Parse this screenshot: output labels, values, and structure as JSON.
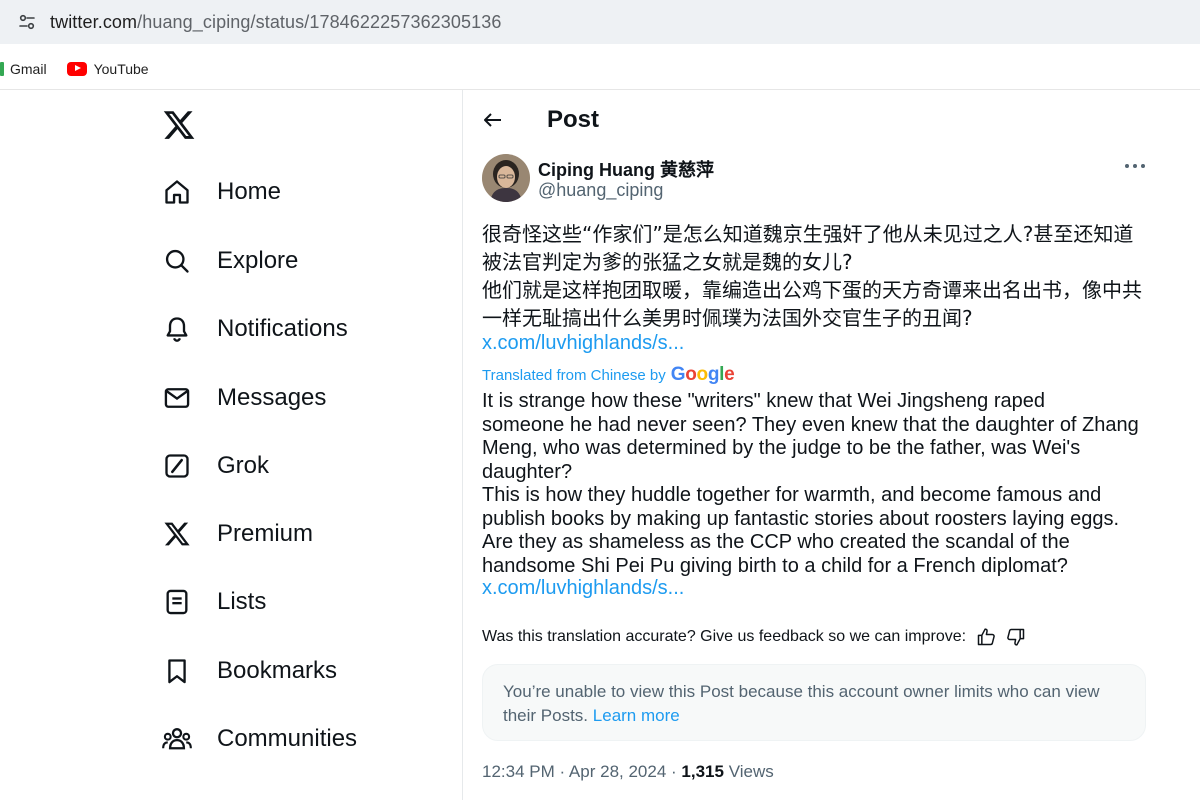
{
  "browser": {
    "url_host": "twitter.com",
    "url_path": "/huang_ciping/status/1784622257362305136",
    "bookmarks": [
      {
        "label": "Gmail",
        "icon": "gmail-icon"
      },
      {
        "label": "YouTube",
        "icon": "youtube-icon"
      }
    ]
  },
  "nav": {
    "items": [
      {
        "label": "Home",
        "icon": "home-icon"
      },
      {
        "label": "Explore",
        "icon": "search-icon"
      },
      {
        "label": "Notifications",
        "icon": "bell-icon"
      },
      {
        "label": "Messages",
        "icon": "envelope-icon"
      },
      {
        "label": "Grok",
        "icon": "grok-icon"
      },
      {
        "label": "Premium",
        "icon": "x-icon"
      },
      {
        "label": "Lists",
        "icon": "list-icon"
      },
      {
        "label": "Bookmarks",
        "icon": "bookmark-icon"
      },
      {
        "label": "Communities",
        "icon": "communities-icon"
      }
    ]
  },
  "post": {
    "header_title": "Post",
    "author_name": "Ciping Huang 黄慈萍",
    "author_handle": "@huang_ciping",
    "original_lines": [
      "很奇怪这些“作家们”是怎么知道魏京生强奸了他从未见过之人?甚至还知道",
      "被法官判定为爹的张猛之女就是魏的女儿?",
      "他们就是这样抱团取暖，靠编造出公鸡下蛋的天方奇谭来出名出书，像中共",
      "一样无耻搞出什么美男时佩璞为法国外交官生子的丑闻?"
    ],
    "original_link": "x.com/luvhighlands/s...",
    "translated_from": "Translated from Chinese by",
    "translator": "Google",
    "translated_lines": [
      "It is strange how these \"writers\" knew that Wei Jingsheng raped",
      "someone he had never seen? They even knew that the daughter of Zhang",
      "Meng, who was determined by the judge to be the father, was Wei's",
      "daughter?",
      "This is how they huddle together for warmth, and become famous and",
      "publish books by making up fantastic stories about roosters laying eggs.",
      "Are they as shameless as the CCP who created the scandal of the",
      "handsome Shi Pei Pu giving birth to a child for a French diplomat?"
    ],
    "translated_link": "x.com/luvhighlands/s...",
    "feedback_text": "Was this translation accurate? Give us feedback so we can improve:",
    "notice_text": "You’re unable to view this Post because this account owner limits who can view their Posts.",
    "notice_link": "Learn more",
    "timestamp": "12:34 PM · Apr 28, 2024 ·",
    "views_count": "1,315",
    "views_label": "Views"
  },
  "colors": {
    "link": "#1d9bf0",
    "secondary_text": "#536471",
    "primary_text": "#0f1419"
  }
}
